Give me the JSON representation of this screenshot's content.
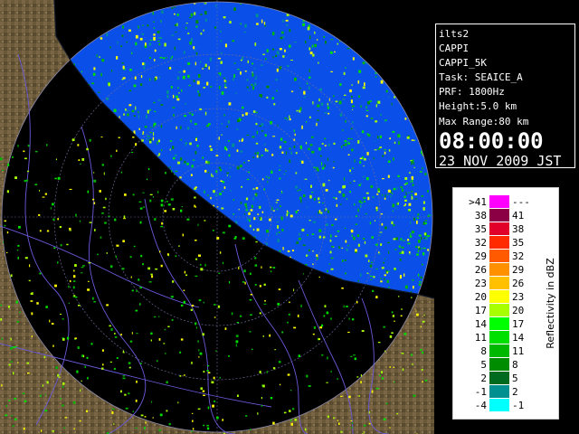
{
  "info": {
    "site": "ilts2",
    "product": "CAPPI",
    "product_name": "CAPPI_5K",
    "task": "Task: SEAICE_A",
    "prf": "PRF: 1800Hz",
    "height": "Height:5.0 km",
    "max_range": "Max Range:80 km",
    "time": "08:00:00",
    "date": "23 NOV 2009 JST"
  },
  "legend": {
    "unit_label": "Reflectivity in dBZ",
    "rows": [
      {
        "lo": ">41",
        "hi": "---",
        "color": "#ff00ff"
      },
      {
        "lo": "38",
        "hi": "41",
        "color": "#8b0045"
      },
      {
        "lo": "35",
        "hi": "38",
        "color": "#e0002a"
      },
      {
        "lo": "32",
        "hi": "35",
        "color": "#ff2a00"
      },
      {
        "lo": "29",
        "hi": "32",
        "color": "#ff5a00"
      },
      {
        "lo": "26",
        "hi": "29",
        "color": "#ff9000"
      },
      {
        "lo": "23",
        "hi": "26",
        "color": "#ffc000"
      },
      {
        "lo": "20",
        "hi": "23",
        "color": "#ffff00"
      },
      {
        "lo": "17",
        "hi": "20",
        "color": "#a8ff00"
      },
      {
        "lo": "14",
        "hi": "17",
        "color": "#00ff00"
      },
      {
        "lo": "11",
        "hi": "14",
        "color": "#00e000"
      },
      {
        "lo": "8",
        "hi": "11",
        "color": "#00b800"
      },
      {
        "lo": "5",
        "hi": "8",
        "color": "#008c00"
      },
      {
        "lo": "2",
        "hi": "5",
        "color": "#006a1e"
      },
      {
        "lo": "-1",
        "hi": "2",
        "color": "#009090"
      },
      {
        "lo": "-4",
        "hi": "-1",
        "color": "#00ffff"
      }
    ]
  },
  "map": {
    "sea_color": "#0a50e8",
    "land_color": "#6b5a3a",
    "ocean_color": "#000000"
  }
}
